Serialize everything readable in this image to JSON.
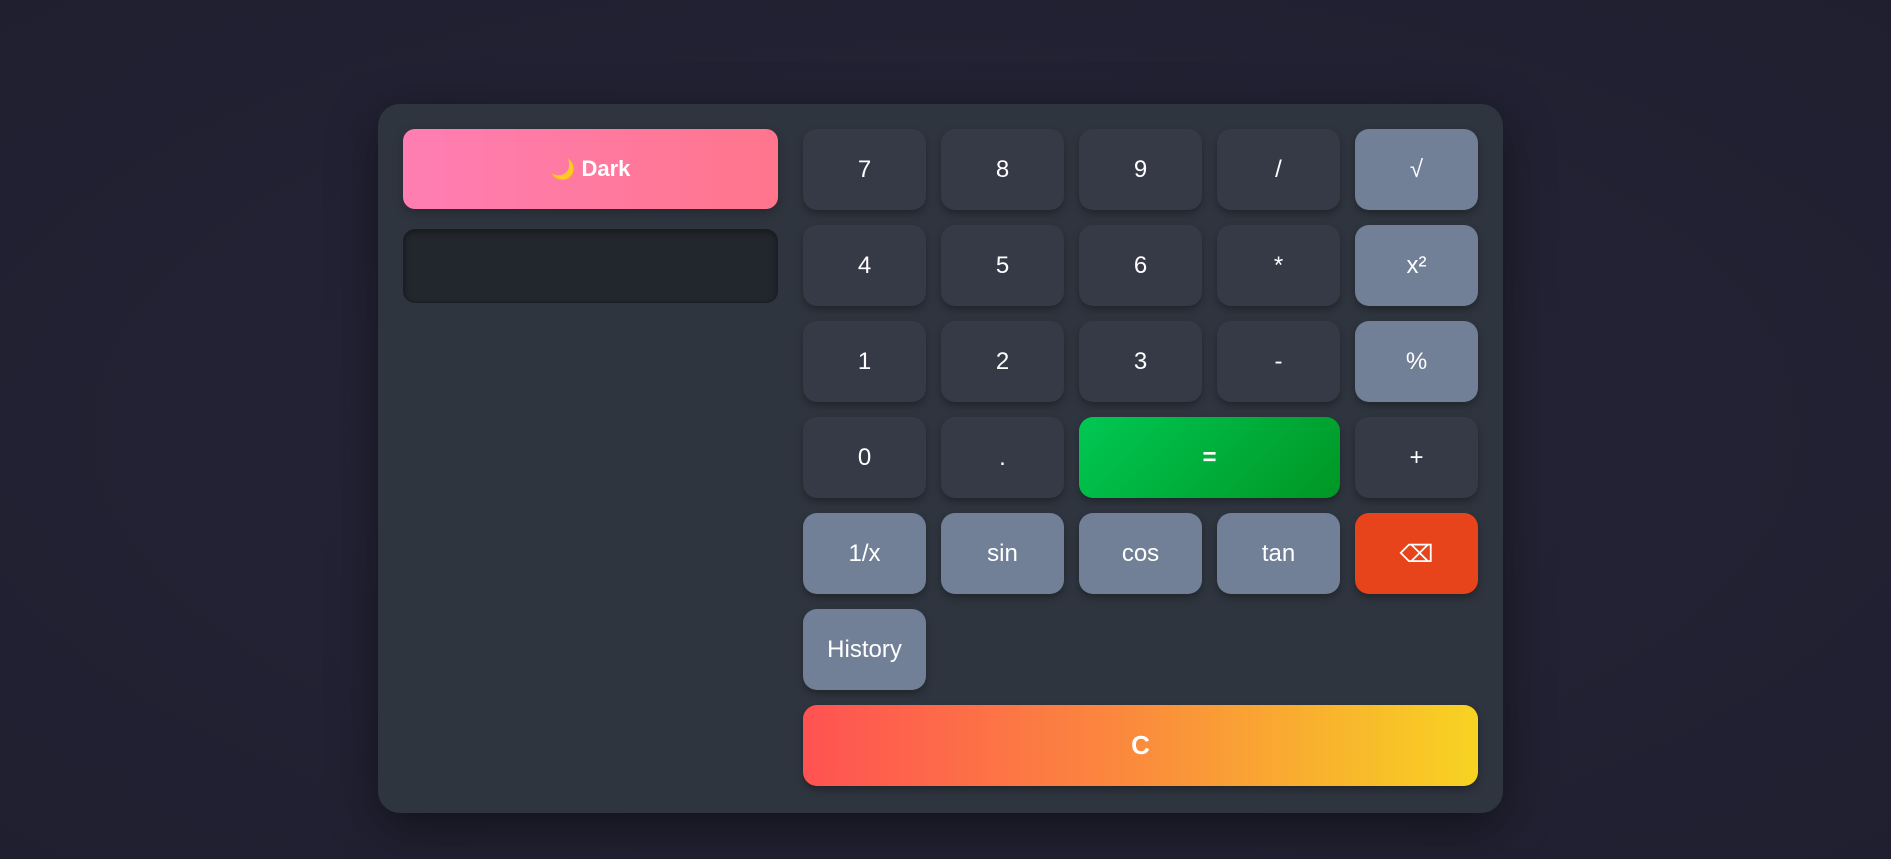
{
  "theme_toggle": {
    "icon": "moon-icon",
    "icon_glyph": "🌙",
    "label": "Dark"
  },
  "display": {
    "value": ""
  },
  "keys": {
    "k7": "7",
    "k8": "8",
    "k9": "9",
    "divide": "/",
    "sqrt": "√",
    "k4": "4",
    "k5": "5",
    "k6": "6",
    "multiply": "*",
    "square": "x²",
    "k1": "1",
    "k2": "2",
    "k3": "3",
    "subtract": "-",
    "percent": "%",
    "k0": "0",
    "decimal": ".",
    "equals": "=",
    "add": "+",
    "reciprocal": "1/x",
    "sin": "sin",
    "cos": "cos",
    "tan": "tan",
    "backspace": "⌫",
    "history": "History",
    "clear": "C"
  },
  "colors": {
    "background": "#22223a",
    "panel": "#2f353f",
    "key": "#363a47",
    "function_key": "#718096",
    "equals": "#00c853",
    "backspace": "#e8441c",
    "theme_toggle": "#ff7eb3",
    "clear_gradient": [
      "#ff5252",
      "#f7d322"
    ]
  }
}
